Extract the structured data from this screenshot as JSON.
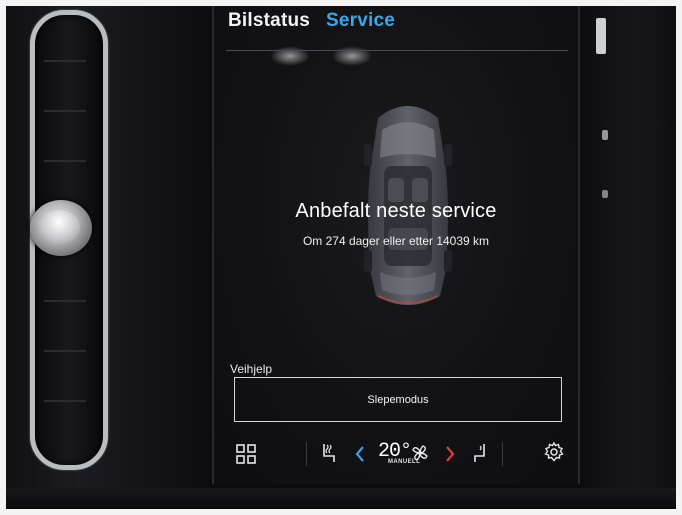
{
  "tabs": [
    {
      "label": "Bilstatus",
      "active": false
    },
    {
      "label": "Service",
      "active": true
    }
  ],
  "service": {
    "title": "Anbefalt neste service",
    "detail": "Om 274 dager eller etter 14039 km"
  },
  "assistance": {
    "section_label": "Veihjelp",
    "tow_mode_button": "Slepemodus"
  },
  "climate": {
    "temperature": "20°",
    "fan_mode": "MANUELL"
  },
  "icons": [
    "apps-grid-icon",
    "seat-heat-left-icon",
    "chevron-left-icon",
    "fan-icon",
    "chevron-right-icon",
    "seat-heat-right-icon",
    "settings-gear-icon"
  ],
  "colors": {
    "accent": "#38a7e6",
    "chevron_left": "#3aa0e8",
    "chevron_right": "#e03a3a"
  }
}
